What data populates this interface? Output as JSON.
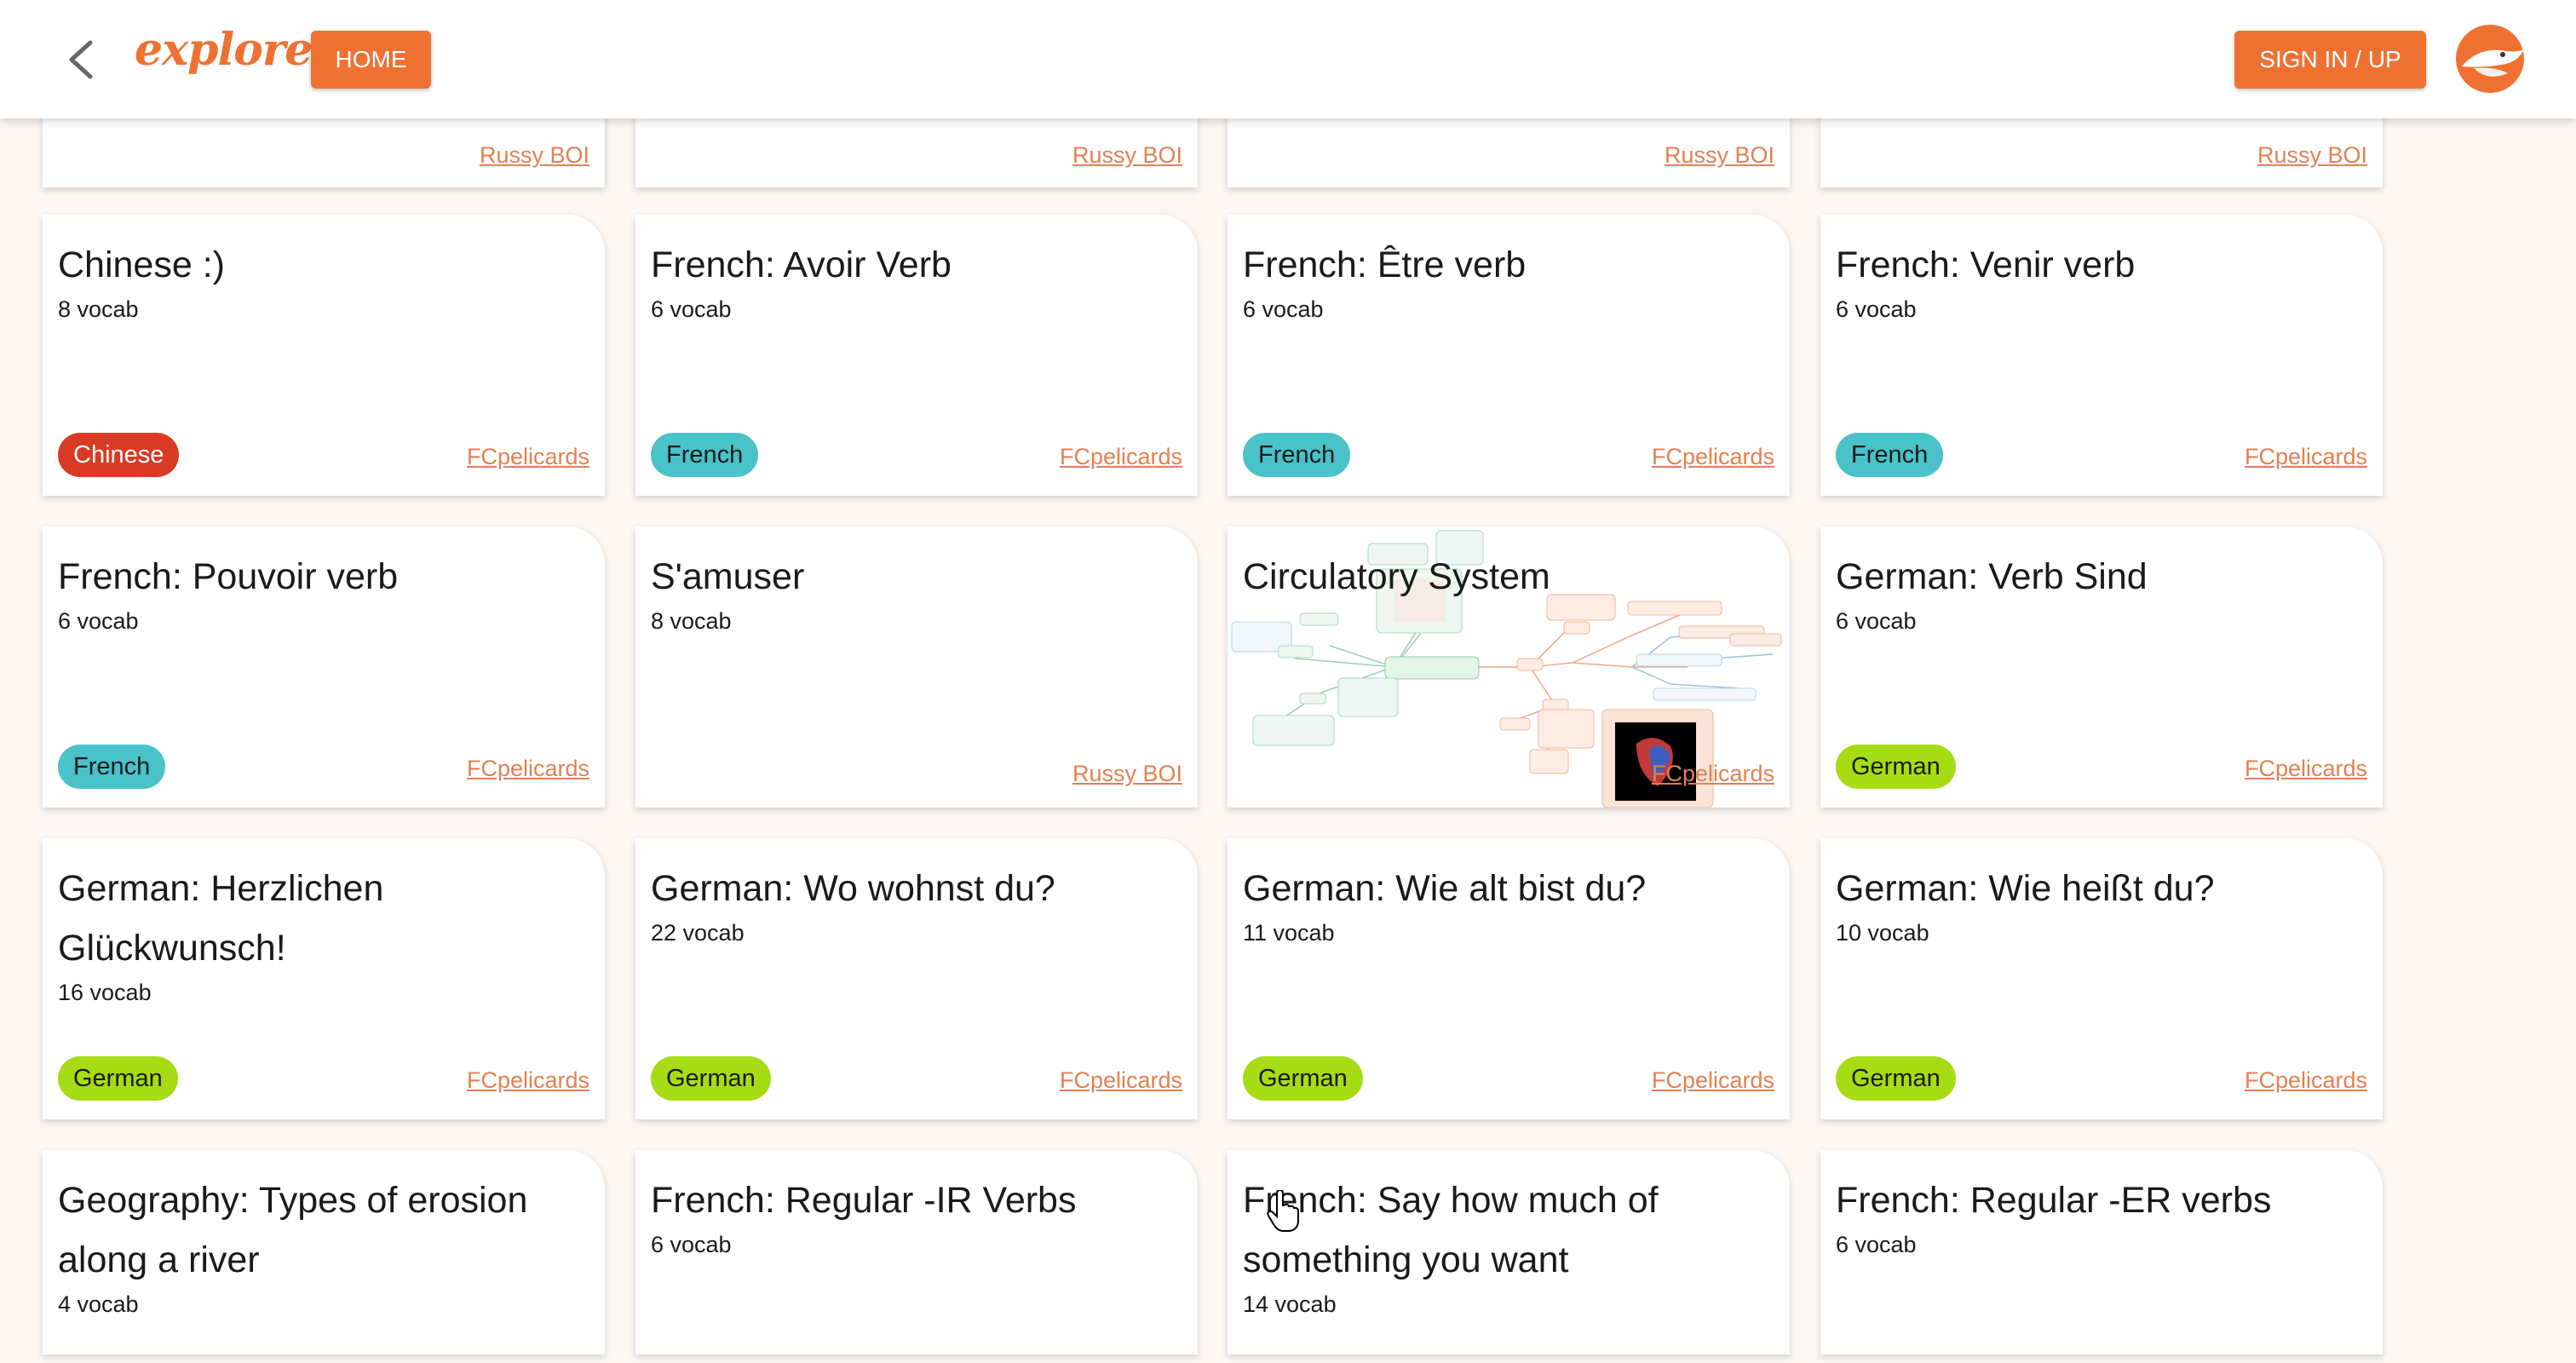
{
  "header": {
    "logo": "explore",
    "home_label": "HOME",
    "signin_label": "SIGN IN / UP"
  },
  "colors": {
    "accent": "#ef7132",
    "chinese": "#d83a23",
    "french": "#49c2c9",
    "german": "#a6dc14",
    "author_link": "#e38052"
  },
  "top_row_authors": [
    "Russy BOI",
    "Russy BOI",
    "Russy BOI",
    "Russy BOI"
  ],
  "cards": [
    {
      "title": "Chinese :)",
      "count": "8 vocab",
      "tag": "Chinese",
      "author": "FCpelicards"
    },
    {
      "title": "French: Avoir Verb",
      "count": "6 vocab",
      "tag": "French",
      "author": "FCpelicards"
    },
    {
      "title": "French: Être verb",
      "count": "6 vocab",
      "tag": "French",
      "author": "FCpelicards"
    },
    {
      "title": "French: Venir verb",
      "count": "6 vocab",
      "tag": "French",
      "author": "FCpelicards"
    },
    {
      "title": "French: Pouvoir verb",
      "count": "6 vocab",
      "tag": "French",
      "author": "FCpelicards"
    },
    {
      "title": "S'amuser",
      "count": "8 vocab",
      "tag": "",
      "author": "Russy BOI"
    },
    {
      "title": "Circulatory System",
      "count": "",
      "tag": "",
      "author": "FCpelicards"
    },
    {
      "title": "German: Verb Sind",
      "count": "6 vocab",
      "tag": "German",
      "author": "FCpelicards"
    },
    {
      "title": "German: Herzlichen Glückwunsch!",
      "count": "16 vocab",
      "tag": "German",
      "author": "FCpelicards"
    },
    {
      "title": "German: Wo wohnst du?",
      "count": "22 vocab",
      "tag": "German",
      "author": "FCpelicards"
    },
    {
      "title": "German: Wie alt bist du?",
      "count": "11 vocab",
      "tag": "German",
      "author": "FCpelicards"
    },
    {
      "title": "German: Wie heißt du?",
      "count": "10 vocab",
      "tag": "German",
      "author": "FCpelicards"
    },
    {
      "title": "Geography: Types of erosion along a river",
      "count": "4 vocab",
      "tag": "",
      "author": ""
    },
    {
      "title": "French: Regular -IR Verbs",
      "count": "6 vocab",
      "tag": "",
      "author": ""
    },
    {
      "title": "French: Say how much of something you want",
      "count": "14 vocab",
      "tag": "",
      "author": ""
    },
    {
      "title": "French: Regular -ER verbs",
      "count": "6 vocab",
      "tag": "",
      "author": ""
    }
  ]
}
